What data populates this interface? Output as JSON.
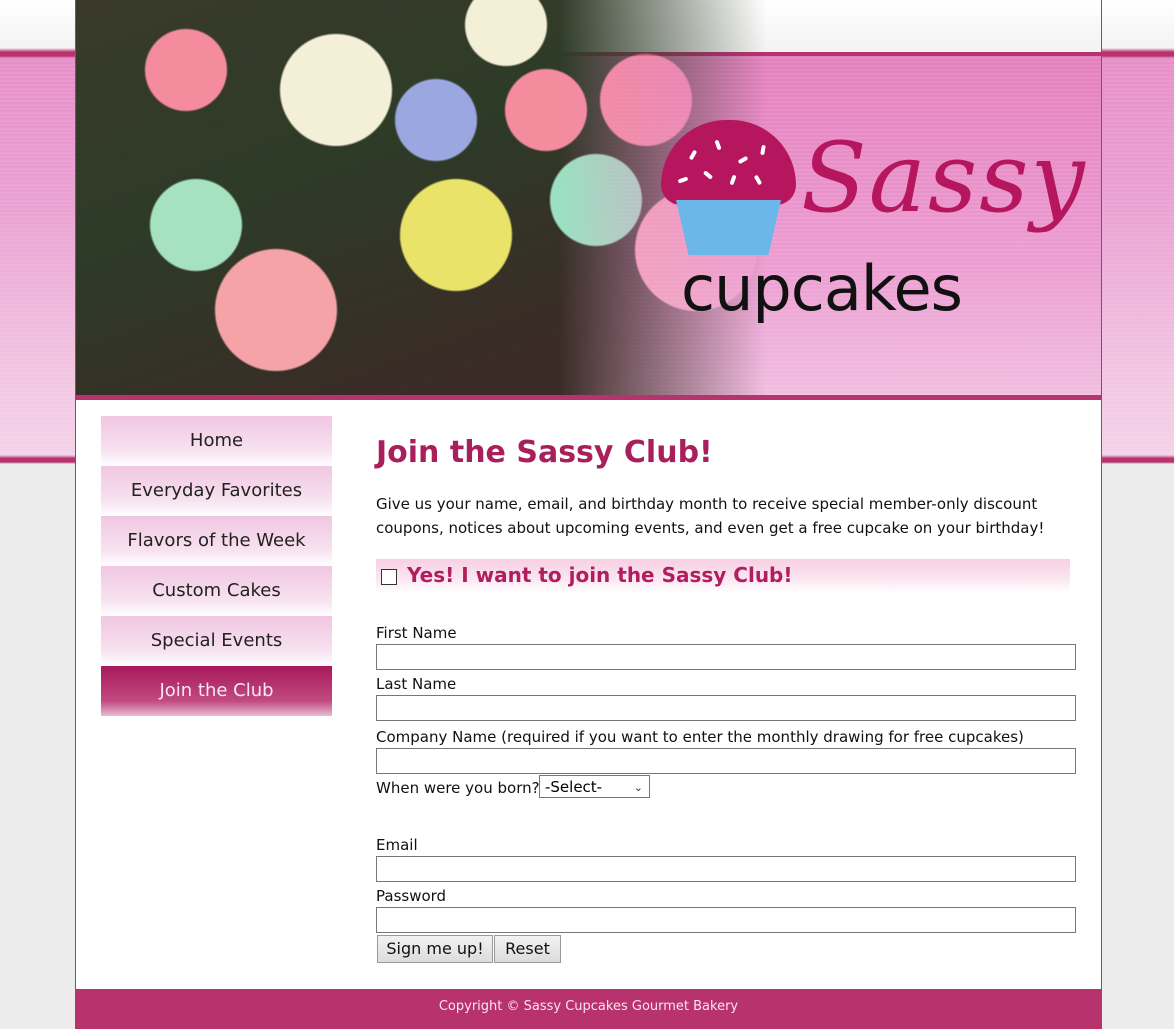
{
  "brand": {
    "title": "Sassy",
    "subtitle": "cupcakes"
  },
  "nav": {
    "items": [
      {
        "label": "Home"
      },
      {
        "label": "Everyday Favorites"
      },
      {
        "label": "Flavors of the Week"
      },
      {
        "label": "Custom Cakes"
      },
      {
        "label": "Special Events"
      },
      {
        "label": "Join the Club"
      }
    ],
    "active_index": 5
  },
  "main": {
    "heading": "Join the Sassy Club!",
    "intro": "Give us your name, email, and birthday month to receive special member-only discount coupons, notices about upcoming events, and even get a free cupcake on your birthday!",
    "join_checkbox_label": "Yes! I want to join the Sassy Club!",
    "join_checked": false
  },
  "form": {
    "first_name_label": "First Name",
    "first_name_value": "",
    "last_name_label": "Last Name",
    "last_name_value": "",
    "company_label": "Company Name (required if you want to enter the monthly drawing for free cupcakes)",
    "company_value": "",
    "born_label": "When were you born?",
    "born_selected": "-Select-",
    "email_label": "Email",
    "email_value": "",
    "password_label": "Password",
    "password_value": "",
    "submit_label": "Sign me up!",
    "reset_label": "Reset"
  },
  "footer": {
    "copyright": "Copyright © Sassy Cupcakes Gourmet Bakery"
  },
  "colors": {
    "accent": "#b8336e",
    "heading": "#a81f5c",
    "active_nav": "#a8195a"
  }
}
